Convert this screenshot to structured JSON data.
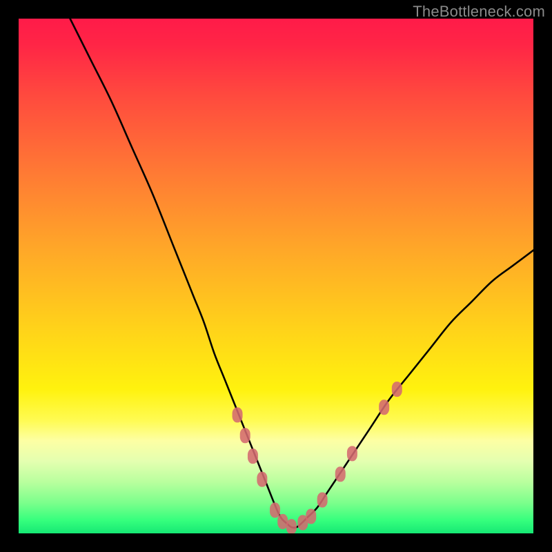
{
  "watermark": "TheBottleneck.com",
  "colors": {
    "frame": "#000000",
    "gradient_stops": [
      {
        "offset": 0.0,
        "color": "#ff1b49"
      },
      {
        "offset": 0.05,
        "color": "#ff2546"
      },
      {
        "offset": 0.15,
        "color": "#ff4a3e"
      },
      {
        "offset": 0.3,
        "color": "#ff7a34"
      },
      {
        "offset": 0.45,
        "color": "#ffa828"
      },
      {
        "offset": 0.6,
        "color": "#ffd21a"
      },
      {
        "offset": 0.72,
        "color": "#fff20e"
      },
      {
        "offset": 0.78,
        "color": "#fffb52"
      },
      {
        "offset": 0.82,
        "color": "#fdffa4"
      },
      {
        "offset": 0.86,
        "color": "#e4ffb0"
      },
      {
        "offset": 0.9,
        "color": "#b9ff9e"
      },
      {
        "offset": 0.94,
        "color": "#7dff8c"
      },
      {
        "offset": 0.975,
        "color": "#35ff7d"
      },
      {
        "offset": 1.0,
        "color": "#16e874"
      }
    ],
    "curve": "#000000",
    "markers": "#d46a70"
  },
  "chart_data": {
    "type": "line",
    "title": "",
    "xlabel": "",
    "ylabel": "",
    "xlim": [
      0,
      100
    ],
    "ylim": [
      0,
      100
    ],
    "series": [
      {
        "name": "bottleneck-curve",
        "x": [
          10,
          14,
          18,
          22,
          26,
          30,
          32,
          34,
          36,
          38,
          40,
          42,
          44,
          46,
          48,
          50,
          51,
          52,
          53,
          54,
          55,
          56,
          58,
          60,
          64,
          68,
          72,
          76,
          80,
          84,
          88,
          92,
          96,
          100
        ],
        "y": [
          100,
          92,
          84,
          75,
          66,
          56,
          51,
          46,
          41,
          35,
          30,
          25,
          20,
          15,
          10,
          5,
          3,
          2,
          1.2,
          1.2,
          2,
          3,
          5,
          8,
          14,
          20,
          26,
          31,
          36,
          41,
          45,
          49,
          52,
          55
        ]
      }
    ],
    "markers": {
      "name": "highlight-points",
      "shape": "rounded-rect",
      "x": [
        42.5,
        44.0,
        45.5,
        47.3,
        49.8,
        51.3,
        53.0,
        55.2,
        56.8,
        59.0,
        62.5,
        64.8,
        71.0,
        73.5
      ],
      "y": [
        23.0,
        19.0,
        15.0,
        10.5,
        4.5,
        2.3,
        1.3,
        2.1,
        3.3,
        6.5,
        11.5,
        15.5,
        24.5,
        28.0
      ]
    }
  }
}
